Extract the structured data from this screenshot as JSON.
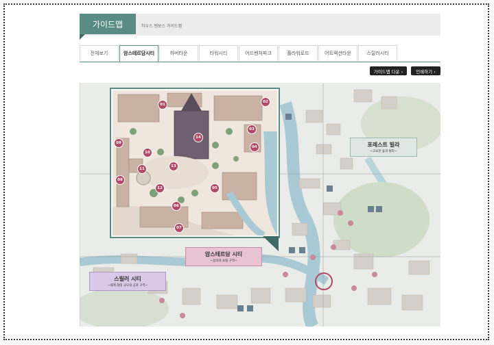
{
  "header": {
    "title": "가이드맵",
    "subtitle": "하우스 텐보스 가이드맵"
  },
  "tabs": [
    "전체보기",
    "암스테르담시티",
    "하버타운",
    "타워시티",
    "어드벤처파크",
    "플라워로드",
    "어트랙션타운",
    "스릴러시티"
  ],
  "active_tab": "암스테르담시티",
  "buttons": {
    "download": "가이드맵 다운 ›",
    "print": "인쇄하기 ›"
  },
  "map": {
    "pins": [
      "01",
      "02",
      "03",
      "04",
      "05",
      "06",
      "07",
      "08",
      "09",
      "10",
      "11",
      "12",
      "13",
      "14"
    ],
    "banners": {
      "forest_villa": {
        "title": "포레스트 빌라",
        "sub": "~고요한 숲과 빌라~"
      },
      "amsterdam": {
        "title": "암스테르담 시티",
        "sub": "~음악과 쇼핑 구역~"
      },
      "thriller": {
        "title": "스릴러 시티",
        "sub": "~세계 최대 규모의 공포 구역~"
      }
    }
  },
  "colors": {
    "accent": "#5a8c86",
    "pin": "#b04a67",
    "banner_pink": "#e8c4d2",
    "banner_purple": "#d9c9e6",
    "banner_teal": "#dfe7e5"
  }
}
